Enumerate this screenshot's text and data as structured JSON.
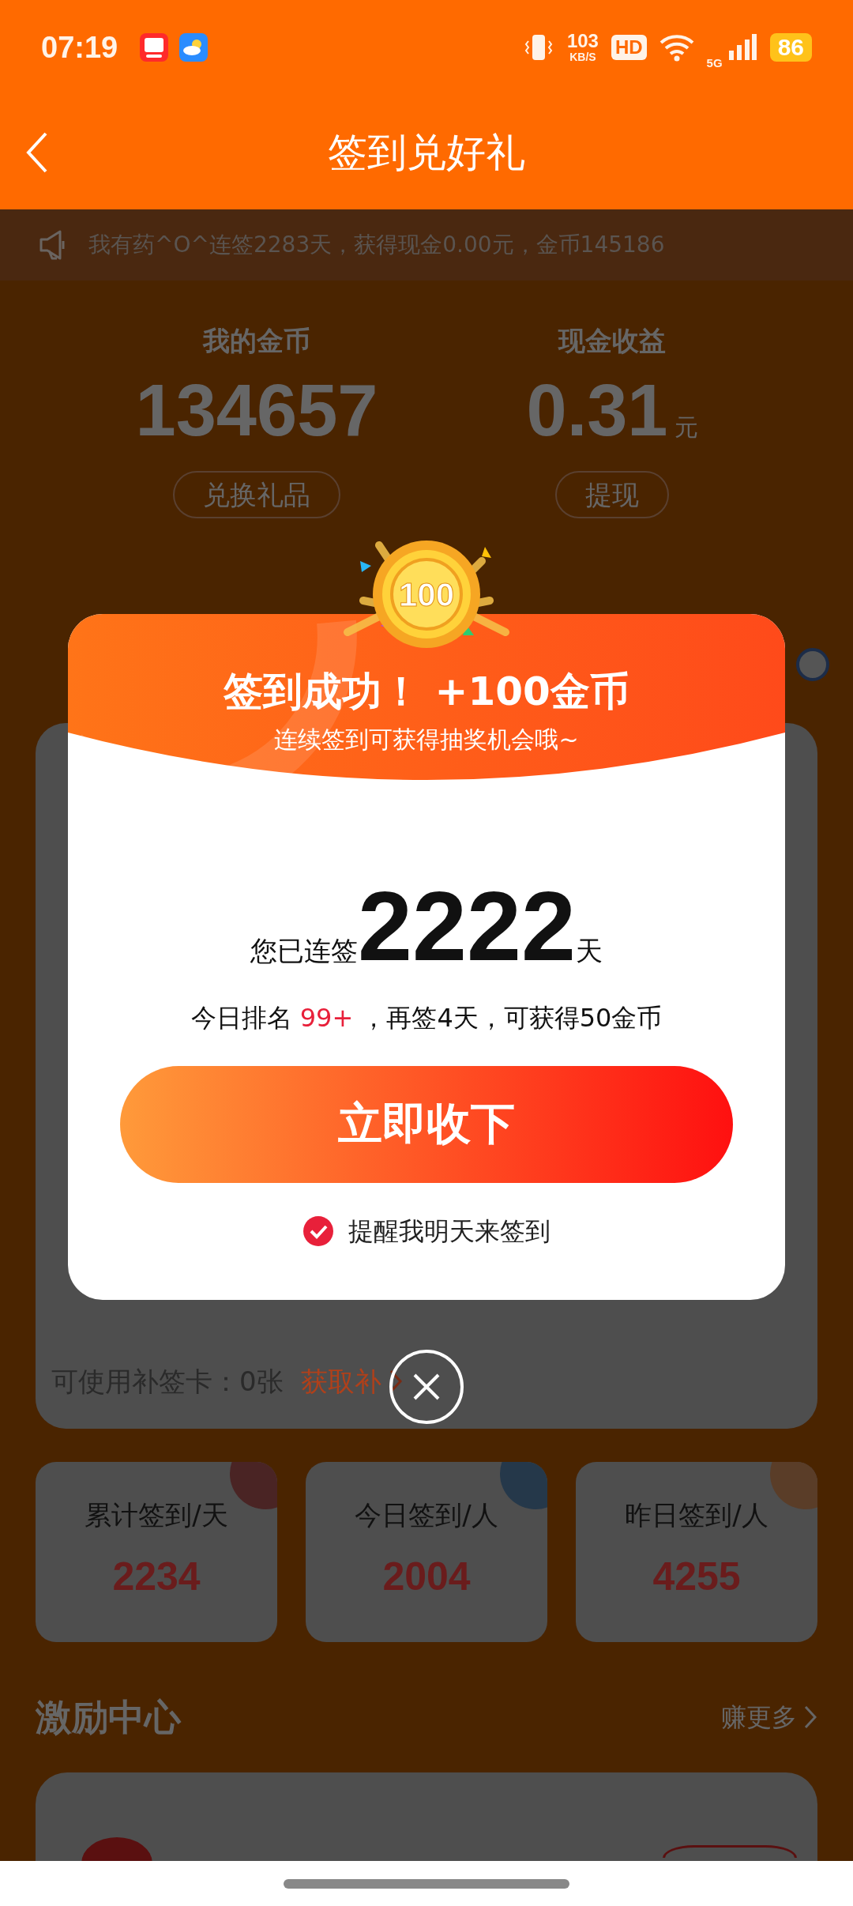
{
  "status_bar": {
    "time": "07:19",
    "speed": "103",
    "speed_unit": "KB/S",
    "hd": "HD",
    "network": "5G",
    "battery": "86"
  },
  "header": {
    "title": "签到兑好礼"
  },
  "notice": {
    "text": "我有药^O^连签2283天，获得现金0.00元，金币145186"
  },
  "wallet": [
    {
      "label": "我的金币",
      "value": "134657",
      "button": "兑换礼品"
    },
    {
      "label": "现金收益",
      "value": "0.31",
      "unit": "元",
      "button": "提现"
    }
  ],
  "makeup": {
    "text": "可使用补签卡：0张",
    "link": "获取补"
  },
  "stats": [
    {
      "label": "累计签到/天",
      "value": "2234",
      "color": "#4a2424"
    },
    {
      "label": "今日签到/人",
      "value": "2004",
      "color": "#25384a"
    },
    {
      "label": "昨日签到/人",
      "value": "4255",
      "color": "#5a3d28"
    }
  ],
  "incentive": {
    "title": "激励中心",
    "more": "赚更多"
  },
  "dialog": {
    "coin": "100",
    "title": "签到成功！ +100金币",
    "subtitle": "连续签到可获得抽奖机会哦~",
    "streak_prefix": "您已连签",
    "streak": "2222",
    "streak_suffix": "天",
    "rank_prefix": "今日排名 ",
    "rank": "99+",
    "rank_suffix": " ，再签4天，可获得50金币",
    "button": "立即收下",
    "remind": {
      "label": "提醒我明天来签到",
      "checked": true
    }
  }
}
